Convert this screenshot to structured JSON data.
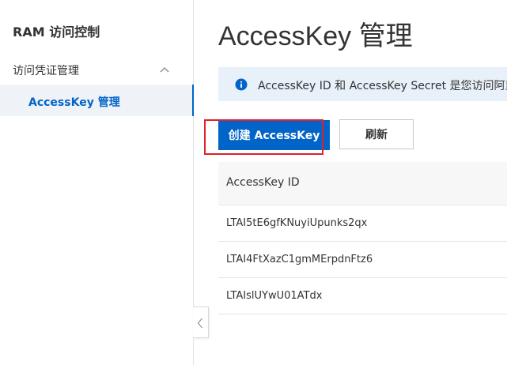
{
  "sidebar": {
    "title": "RAM 访问控制",
    "group_label": "访问凭证管理",
    "active_item_label": "AccessKey 管理"
  },
  "main": {
    "page_title": "AccessKey 管理",
    "notice_text": "AccessKey ID 和 AccessKey Secret 是您访问阿里",
    "create_button_label": "创建 AccessKey",
    "refresh_button_label": "刷新",
    "table": {
      "column_header": "AccessKey ID",
      "rows": [
        "LTAI5tE6gfKNuyiUpunks2qx",
        "LTAI4FtXazC1gmMErpdnFtz6",
        "LTAIslUYwU01ATdx"
      ]
    }
  },
  "colors": {
    "brand_blue": "#0064c8",
    "highlight_red": "#e0202a",
    "notice_bg": "#e8f0f9",
    "active_nav_bg": "#eff3f8"
  },
  "icons": {
    "group_chevron": "chevron-up-icon",
    "notice": "info-icon",
    "collapse": "chevron-left-icon"
  }
}
